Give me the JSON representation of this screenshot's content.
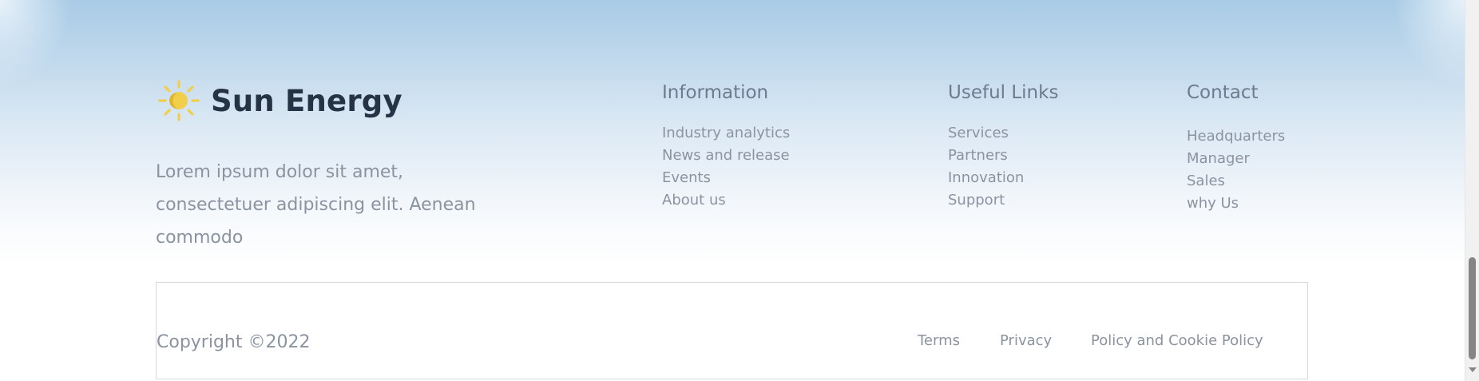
{
  "brand": {
    "name": "Sun Energy",
    "icon": "sun-icon",
    "icon_color": "#f2cf4a",
    "description": "Lorem ipsum dolor sit amet, consectetuer adipiscing elit. Aenean commodo"
  },
  "columns": {
    "information": {
      "title": "Information",
      "items": [
        "Industry analytics",
        "News and release",
        "Events",
        "About us"
      ]
    },
    "useful_links": {
      "title": "Useful Links",
      "items": [
        "Services",
        "Partners",
        "Innovation",
        "Support"
      ]
    },
    "contact": {
      "title": "Contact",
      "items": [
        "Headquarters",
        "Manager",
        "Sales",
        "why Us"
      ]
    }
  },
  "bottom": {
    "copyright": "Copyright ©2022",
    "links": [
      "Terms",
      "Privacy",
      "Policy and Cookie Policy"
    ]
  },
  "colors": {
    "heading": "#263246",
    "text": "#8b93a1",
    "sky": "#a9cbe5"
  }
}
